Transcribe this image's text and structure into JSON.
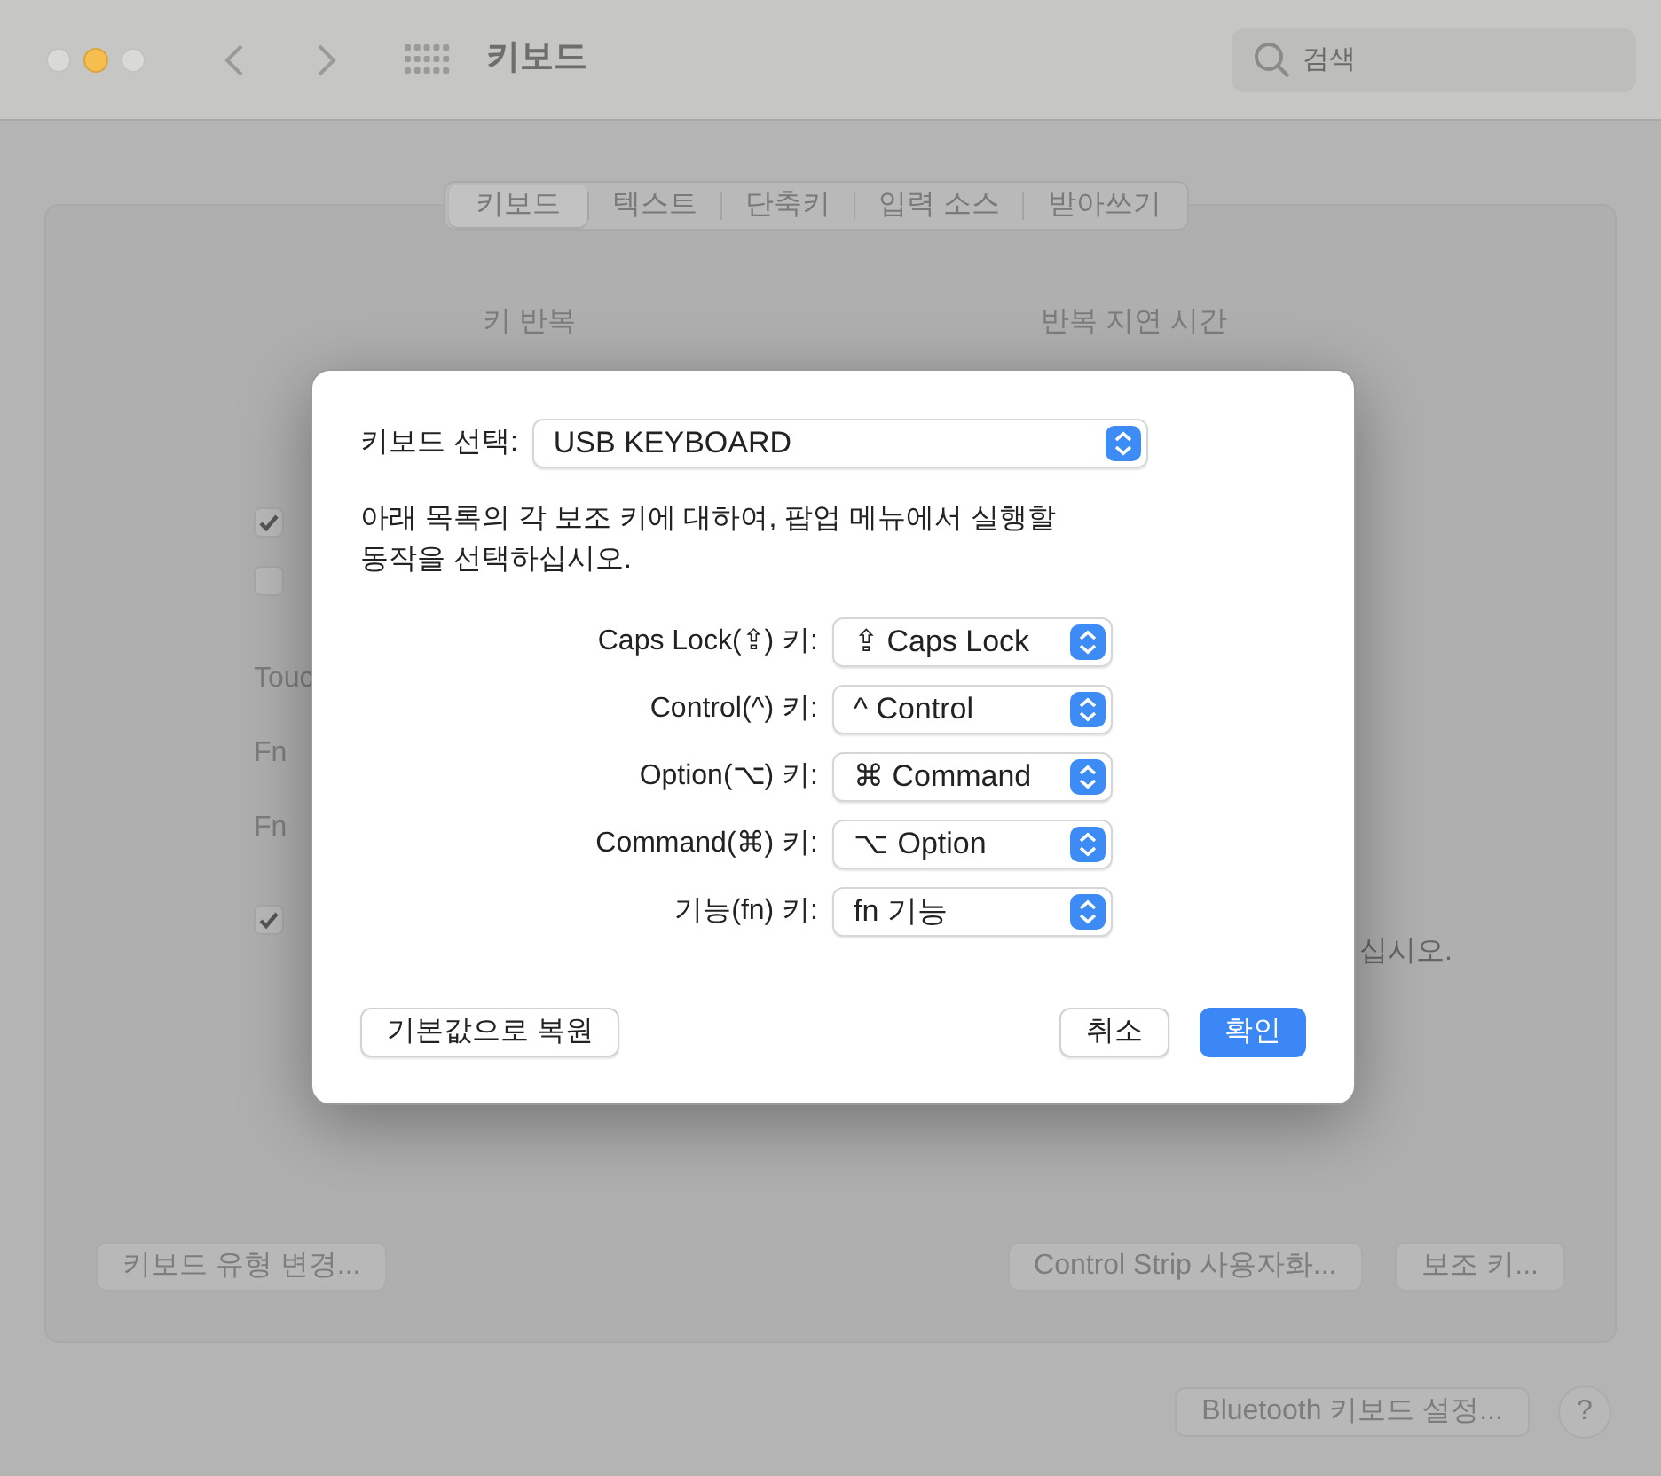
{
  "window": {
    "title": "키보드",
    "search": {
      "placeholder": "검색"
    }
  },
  "tabs": [
    {
      "label": "키보드",
      "selected": true
    },
    {
      "label": "텍스트",
      "selected": false
    },
    {
      "label": "단축키",
      "selected": false
    },
    {
      "label": "입력 소스",
      "selected": false
    },
    {
      "label": "받아쓰기",
      "selected": false
    }
  ],
  "section_labels": [
    "키 반복",
    "반복 지연 시간"
  ],
  "background_rows": [
    {
      "kind": "checkbox",
      "checked": true
    },
    {
      "kind": "checkbox",
      "checked": false
    },
    {
      "kind": "text",
      "text": "Touc"
    },
    {
      "kind": "text",
      "text": "Fn"
    },
    {
      "kind": "text",
      "text": "Fn"
    },
    {
      "kind": "checkbox",
      "checked": true
    }
  ],
  "background_note": "십시오.",
  "panel_buttons": [
    "키보드 유형 변경...",
    "Control Strip 사용자화...",
    "보조 키..."
  ],
  "footer_buttons": [
    "Bluetooth 키보드 설정...",
    "?"
  ],
  "dialog": {
    "keyboard_label": "키보드 선택:",
    "keyboard": "USB KEYBOARD",
    "description": "아래 목록의 각 보조 키에 대하여, 팝업 메뉴에서 실행할 동작을 선택하십시오.",
    "mappings": [
      {
        "label": "Caps Lock(⇪) 키:",
        "value": "⇪ Caps Lock"
      },
      {
        "label": "Control(^) 키:",
        "value": "^ Control"
      },
      {
        "label": "Option(⌥) 키:",
        "value": "⌘ Command"
      },
      {
        "label": "Command(⌘) 키:",
        "value": "⌥ Option"
      },
      {
        "label": "기능(fn) 키:",
        "value": "fn 기능"
      }
    ],
    "buttons": [
      {
        "label": "기본값으로 복원",
        "kind": "normal"
      },
      {
        "label": "취소",
        "kind": "normal"
      },
      {
        "label": "확인",
        "kind": "default"
      }
    ]
  }
}
